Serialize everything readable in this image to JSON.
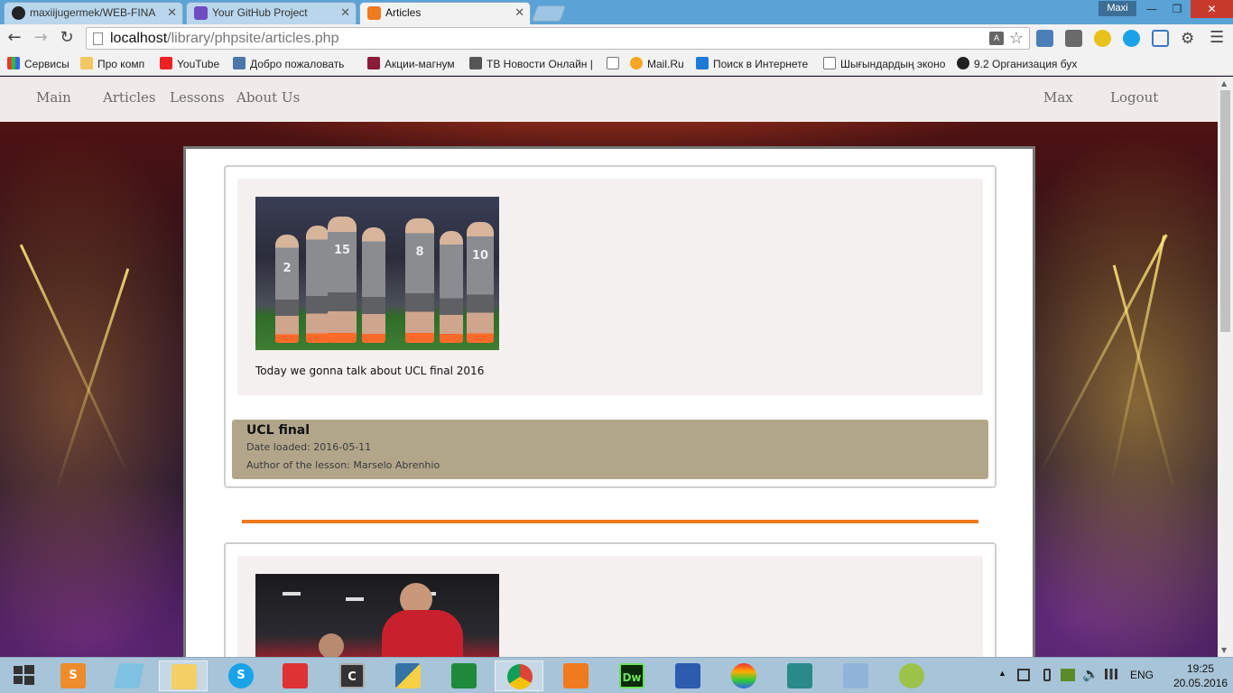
{
  "browser": {
    "tabs": [
      {
        "title": "maxiijugermek/WEB-FINA",
        "icon": "github-icon"
      },
      {
        "title": "Your GitHub Project",
        "icon": "list-icon"
      },
      {
        "title": "Articles",
        "icon": "xampp-icon"
      }
    ],
    "profile": "Maxi",
    "url_host": "localhost",
    "url_path": "/library/phpsite/articles.php",
    "bookmarks": [
      "Сервисы",
      "Про комп",
      "YouTube",
      "Добро пожаловать",
      "Акции-магнум",
      "ТВ Новости Онлайн |",
      "Mail.Ru",
      "Поиск в Интернете",
      "Шығындардың эконо",
      "9.2 Организация бух"
    ]
  },
  "site": {
    "nav": {
      "main": "Main",
      "articles": "Articles",
      "lessons": "Lessons",
      "about": "About Us",
      "user": "Max",
      "logout": "Logout"
    },
    "articles": [
      {
        "summary": "Today we gonna talk about UCL final 2016",
        "title": "UCL final",
        "date": "Date loaded: 2016-05-11",
        "author": "Author of the lesson: Marselo Abrenhio",
        "jersey_numbers": [
          "2",
          "15",
          "8",
          "10"
        ]
      }
    ],
    "accent_color": "#f07a1e",
    "meta_bg": "#b2a68a"
  },
  "taskbar": {
    "language": "ENG",
    "time": "19:25",
    "date": "20.05.2016"
  }
}
